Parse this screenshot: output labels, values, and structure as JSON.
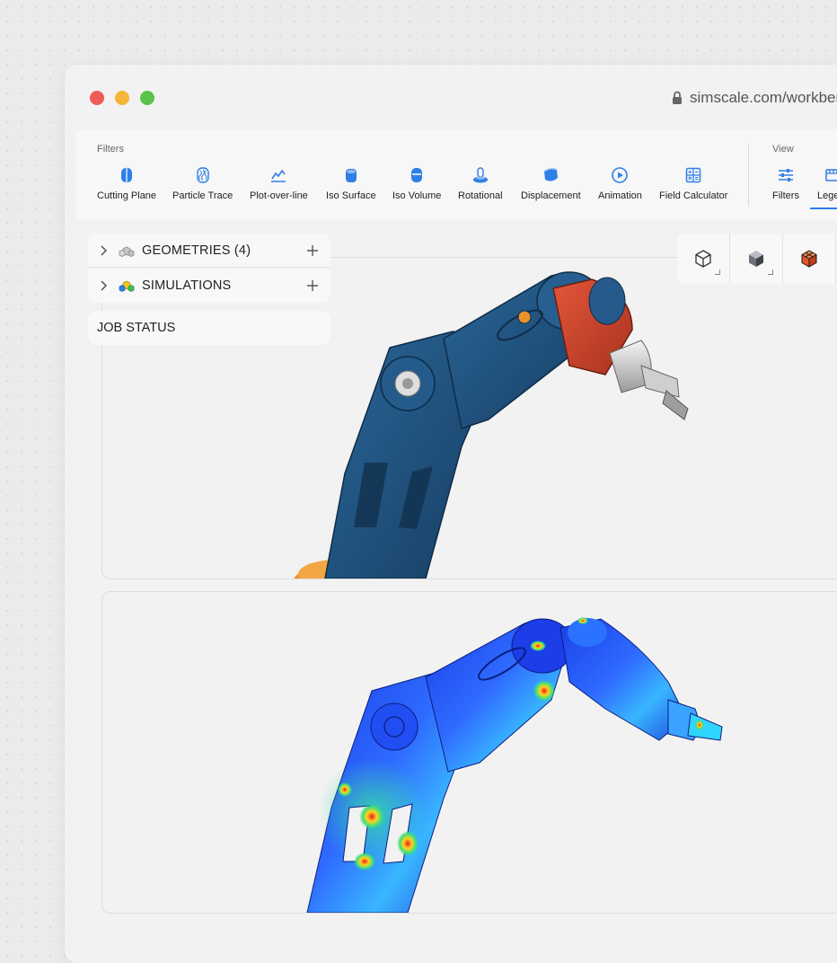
{
  "window": {
    "url": "simscale.com/workbench"
  },
  "toolbar": {
    "filters_label": "Filters",
    "view_label": "View",
    "tools": [
      {
        "label": "Cutting Plane",
        "icon": "cutting-plane-icon"
      },
      {
        "label": "Particle Trace",
        "icon": "particle-trace-icon"
      },
      {
        "label": "Plot-over-line",
        "icon": "plot-over-line-icon"
      },
      {
        "label": "Iso Surface",
        "icon": "iso-surface-icon"
      },
      {
        "label": "Iso Volume",
        "icon": "iso-volume-icon"
      },
      {
        "label": "Rotational",
        "icon": "rotational-icon"
      },
      {
        "label": "Displacement",
        "icon": "displacement-icon"
      },
      {
        "label": "Animation",
        "icon": "animation-icon"
      },
      {
        "label": "Field Calculator",
        "icon": "field-calculator-icon"
      }
    ],
    "view_tools": [
      {
        "label": "Filters",
        "icon": "filters-sliders-icon"
      },
      {
        "label": "Legend",
        "icon": "legend-icon"
      }
    ]
  },
  "tree": {
    "geometries_label": "GEOMETRIES (4)",
    "simulations_label": "SIMULATIONS",
    "job_status_label": "JOB STATUS"
  },
  "colors": {
    "accent": "#2b7de9",
    "icon_blue": "#2f7fe6",
    "mesh_blue": "#1d4f7c",
    "mesh_red": "#d2452c",
    "mesh_orange": "#e8922e"
  }
}
